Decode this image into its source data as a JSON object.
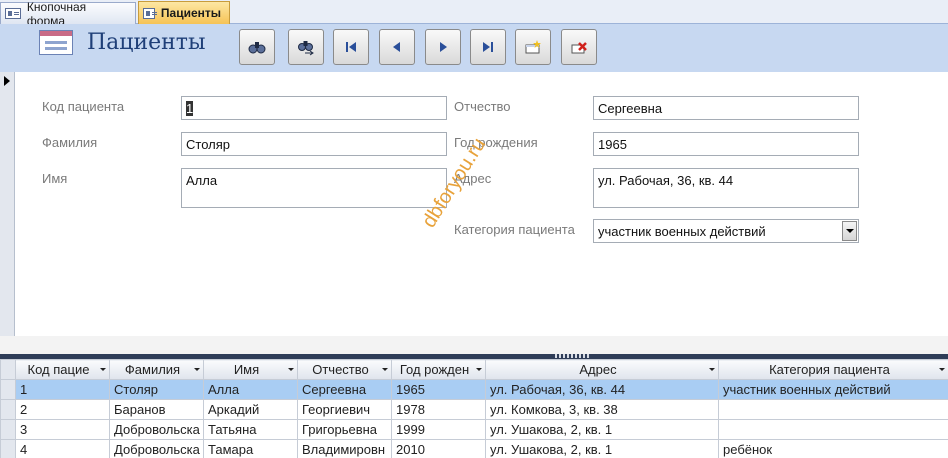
{
  "tabs": [
    {
      "label": "Кнопочная форма",
      "active": false
    },
    {
      "label": "Пациенты",
      "active": true
    }
  ],
  "header": {
    "title": "Пациенты",
    "buttons": [
      "find-icon",
      "find-next-icon",
      "first-record-icon",
      "previous-record-icon",
      "next-record-icon",
      "last-record-icon",
      "new-record-icon",
      "delete-record-icon"
    ]
  },
  "form": {
    "patient_code": {
      "label": "Код пациента",
      "value": "1"
    },
    "surname": {
      "label": "Фамилия",
      "value": "Столяр"
    },
    "name": {
      "label": "Имя",
      "value": "Алла"
    },
    "patronymic": {
      "label": "Отчество",
      "value": "Сергеевна"
    },
    "birth_year": {
      "label": "Год рождения",
      "value": "1965"
    },
    "address": {
      "label": "Адрес",
      "value": "ул. Рабочая, 36, кв. 44"
    },
    "category": {
      "label": "Категория пациента",
      "value": "участник военных действий"
    }
  },
  "watermark": "dbforyou.ru",
  "grid": {
    "columns": [
      "Код пацие",
      "Фамилия",
      "Имя",
      "Отчество",
      "Год рожден",
      "Адрес",
      "Категория пациента"
    ],
    "rows": [
      [
        "1",
        "Столяр",
        "Алла",
        "Сергеевна",
        "1965",
        "ул. Рабочая, 36, кв. 44",
        "участник военных действий"
      ],
      [
        "2",
        "Баранов",
        "Аркадий",
        "Георгиевич",
        "1978",
        "ул. Комкова, 3, кв. 38",
        ""
      ],
      [
        "3",
        "Добровольска",
        "Татьяна",
        "Григорьевна",
        "1999",
        "ул. Ушакова, 2, кв. 1",
        ""
      ],
      [
        "4",
        "Добровольска",
        "Тамара",
        "Владимировн",
        "2010",
        "ул. Ушакова, 2, кв. 1",
        "ребёнок"
      ]
    ],
    "current_row": 0
  },
  "colors": {
    "header_bg": "#c7d8f1",
    "active_tab": "#f6c356",
    "selected_row": "#a9cdf3",
    "watermark": "#e8a23a"
  }
}
